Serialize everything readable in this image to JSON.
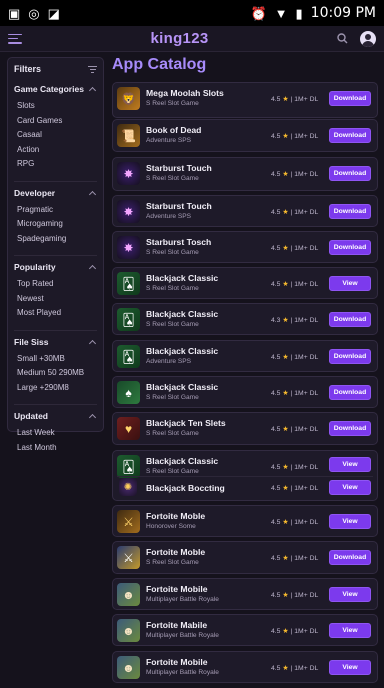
{
  "status": {
    "time": "10:09 PM"
  },
  "brand": "king123",
  "page_title": "App Catalog",
  "filters": {
    "title": "Filters",
    "groups": [
      {
        "title": "Game Categories",
        "items": [
          "Slots",
          "Card Games",
          "Casaal",
          "Action",
          "RPG"
        ]
      },
      {
        "title": "Developer",
        "items": [
          "Pragmatic",
          "Microgaming",
          "Spadegaming"
        ]
      },
      {
        "title": "Popularity",
        "items": [
          "Top Rated",
          "Newest",
          "Most Played"
        ]
      },
      {
        "title": "File Siss",
        "items": [
          "Small +30MB",
          "Medium 50 290MB",
          "Large +290M8"
        ]
      },
      {
        "title": "Updated",
        "items": [
          "Last Week",
          "Last Month"
        ]
      }
    ]
  },
  "apps": [
    {
      "title": "Mega Moolah Slots",
      "sub": "S Reel Slot Game",
      "rating": "4.5",
      "dl": "1M+ DL",
      "btn": "Download",
      "icon": "mega-moolah-icon",
      "glyph": "🦁",
      "theme": "t-orange"
    },
    {
      "title": "Book of Dead",
      "sub": "Adventure SPS",
      "rating": "4.5",
      "dl": "1M+ DL",
      "btn": "Download",
      "icon": "book-of-dead-icon",
      "glyph": "📜",
      "theme": "t-gold"
    },
    {
      "title": "Starburst Touch",
      "sub": "S Reel Slot Game",
      "rating": "4.5",
      "dl": "1M+ DL",
      "btn": "Download",
      "icon": "starburst-icon",
      "glyph": "✸",
      "theme": "t-star"
    },
    {
      "title": "Starburst Touch",
      "sub": "Adventure SPS",
      "rating": "4.5",
      "dl": "1M+ DL",
      "btn": "Download",
      "icon": "starburst-icon",
      "glyph": "✸",
      "theme": "t-star"
    },
    {
      "title": "Starburst Tosch",
      "sub": "S Reel Slot Game",
      "rating": "4.5",
      "dl": "1M+ DL",
      "btn": "Download",
      "icon": "starburst-icon",
      "glyph": "✸",
      "theme": "t-star"
    },
    {
      "title": "Blackjack Classic",
      "sub": "S Reel Slot Game",
      "rating": "4.5",
      "dl": "1M+ DL",
      "btn": "View",
      "icon": "blackjack-cards-icon",
      "glyph": "🂡",
      "theme": "t-green"
    },
    {
      "title": "Blackjack Classic",
      "sub": "S Reel Slot Game",
      "rating": "4.3",
      "dl": "1M+ DL",
      "btn": "Download",
      "icon": "blackjack-cards-icon",
      "glyph": "🂡",
      "theme": "t-green"
    },
    {
      "title": "Blackjack Classic",
      "sub": "Adventure SPS",
      "rating": "4.5",
      "dl": "1M+ DL",
      "btn": "Download",
      "icon": "blackjack-cards-icon",
      "glyph": "🂡",
      "theme": "t-green"
    },
    {
      "title": "Blackjack Classic",
      "sub": "S Reel Slot Game",
      "rating": "4.5",
      "dl": "1M+ DL",
      "btn": "Download",
      "icon": "blackjack-chips-icon",
      "glyph": "♠",
      "theme": "t-jack"
    },
    {
      "title": "Blackjack Ten Slets",
      "sub": "S Reel Slot Game",
      "rating": "4.5",
      "dl": "1M+ DL",
      "btn": "Download",
      "icon": "blackjack-slots-icon",
      "glyph": "♥",
      "theme": "t-red"
    },
    {
      "title": "Blackjack Classic",
      "sub": "S Reel Slot Game",
      "rating": "4.5",
      "dl": "1M+ DL",
      "btn": "View",
      "icon": "blackjack-cards-icon",
      "glyph": "🂡",
      "theme": "t-green"
    },
    {
      "title": "Blackjack Boccting",
      "sub": "",
      "rating": "4.5",
      "dl": "1M+ DL",
      "btn": "View",
      "icon": "sunburst-icon",
      "glyph": "✺",
      "theme": "t-sun"
    },
    {
      "title": "Fortoite Moble",
      "sub": "Honorover Some",
      "rating": "4.5",
      "dl": "1M+ DL",
      "btn": "View",
      "icon": "fortnite-icon",
      "glyph": "⚔",
      "theme": "t-gold"
    },
    {
      "title": "Fortoite Moble",
      "sub": "S Reel Slot Game",
      "rating": "4.5",
      "dl": "1M+ DL",
      "btn": "Download",
      "icon": "fortnite-icon",
      "glyph": "⚔",
      "theme": "t-blue"
    },
    {
      "title": "Fortoite Mobile",
      "sub": "Multiplayer Battle Royale",
      "rating": "4.5",
      "dl": "1M+ DL",
      "btn": "View",
      "icon": "fortnite-character-icon",
      "glyph": "☻",
      "theme": "t-fort"
    },
    {
      "title": "Fortoite Mabile",
      "sub": "Multiplayer Battle Royale",
      "rating": "4.5",
      "dl": "1M+ DL",
      "btn": "View",
      "icon": "fortnite-character-icon",
      "glyph": "☻",
      "theme": "t-fort"
    },
    {
      "title": "Fortoite Mobile",
      "sub": "Multiplayer Battle Royale",
      "rating": "4.5",
      "dl": "1M+ DL",
      "btn": "View",
      "icon": "fortnite-character-icon",
      "glyph": "☻",
      "theme": "t-fort"
    }
  ]
}
